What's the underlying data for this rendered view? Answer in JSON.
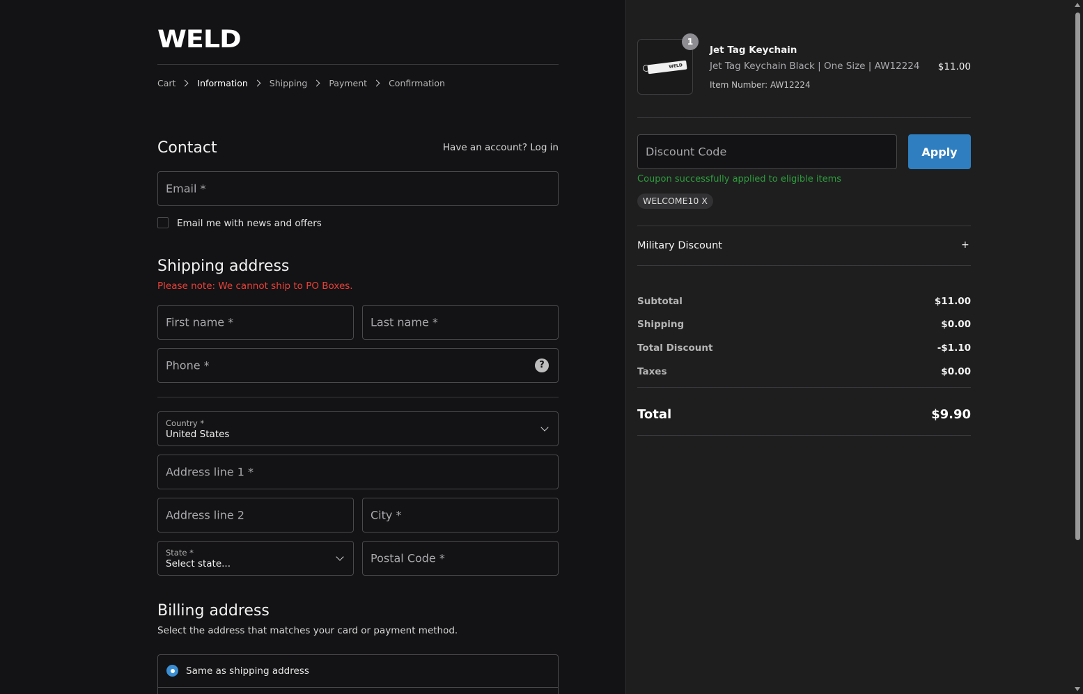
{
  "brand": {
    "logo_text": "WELD"
  },
  "breadcrumb": [
    {
      "label": "Cart"
    },
    {
      "label": "Information",
      "active": true
    },
    {
      "label": "Shipping"
    },
    {
      "label": "Payment"
    },
    {
      "label": "Confirmation"
    }
  ],
  "contact": {
    "title": "Contact",
    "login_prompt": "Have an account? Log in",
    "email_placeholder": "Email *",
    "newsletter_label": "Email me with news and offers",
    "newsletter_checked": false
  },
  "shipping": {
    "title": "Shipping address",
    "po_note": "Please note: We cannot ship to PO Boxes.",
    "first_name_placeholder": "First name *",
    "last_name_placeholder": "Last name *",
    "phone_placeholder": "Phone *",
    "help_icon": "?",
    "country_label": "Country *",
    "country_value": "United States",
    "address1_placeholder": "Address line 1 *",
    "address2_placeholder": "Address line 2",
    "city_placeholder": "City *",
    "state_label": "State *",
    "state_value": "Select state...",
    "postal_placeholder": "Postal Code *"
  },
  "billing": {
    "title": "Billing address",
    "subtitle": "Select the address that matches your card or payment method.",
    "option_same": "Same as shipping address",
    "option_same_selected": true
  },
  "order": {
    "item": {
      "quantity": "1",
      "name": "Jet Tag Keychain",
      "variant": "Jet Tag Keychain Black | One Size | AW12224",
      "item_number": "Item Number: AW12224",
      "price": "$11.00",
      "image_tag_text": "WELD"
    },
    "discount": {
      "placeholder": "Discount Code",
      "apply_label": "Apply",
      "success_message": "Coupon successfully applied to eligible items",
      "applied_code": "WELCOME10 X"
    },
    "military": {
      "label": "Military Discount",
      "toggle": "+"
    },
    "summary": {
      "subtotal_label": "Subtotal",
      "subtotal_value": "$11.00",
      "shipping_label": "Shipping",
      "shipping_value": "$0.00",
      "discount_label": "Total Discount",
      "discount_value": "-$1.10",
      "taxes_label": "Taxes",
      "taxes_value": "$0.00",
      "total_label": "Total",
      "total_value": "$9.90"
    }
  },
  "colors": {
    "accent": "#2f7fc0",
    "error": "#e8423a",
    "success": "#2e9d3c",
    "left_bg": "#131214",
    "right_bg": "#1e1e1f"
  }
}
